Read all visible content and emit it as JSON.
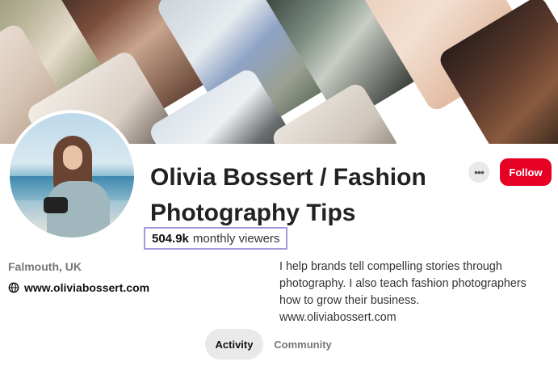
{
  "profile": {
    "name": "Olivia Bossert / Fashion Photography Tips",
    "monthly_viewers_count": "504.9k",
    "monthly_viewers_label": "monthly viewers",
    "location": "Falmouth, UK",
    "website": "www.oliviabossert.com",
    "bio": "I help brands tell compelling stories through photography. I also teach fashion photographers how to grow their business. www.oliviabossert.com"
  },
  "actions": {
    "more_label": "•••",
    "follow_label": "Follow"
  },
  "tabs": [
    {
      "label": "Activity",
      "selected": true
    },
    {
      "label": "Community",
      "selected": false
    }
  ],
  "icons": {
    "website": "globe-icon",
    "more": "ellipsis-icon"
  },
  "colors": {
    "follow_button": "#e60023",
    "highlight_border": "#a898dc",
    "tab_selected_bg": "#e9e9e9",
    "muted_text": "#767676"
  }
}
